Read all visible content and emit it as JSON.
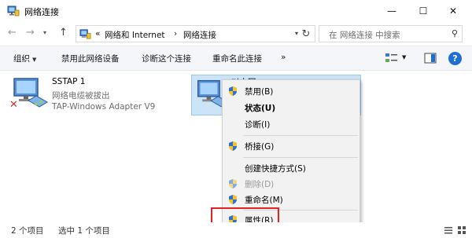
{
  "window": {
    "title": "网络连接",
    "minimize_glyph": "—",
    "maximize_glyph": "☐",
    "close_glyph": "✕"
  },
  "address": {
    "back_icon": "arrow-left-icon",
    "forward_icon": "arrow-right-icon",
    "up_icon": "arrow-up-icon",
    "back_glyph": "←",
    "forward_glyph": "→",
    "dropdown_glyph": "▾",
    "up_glyph": "↑",
    "overflow": "«",
    "crumb1": "网络和 Internet",
    "crumb_sep": "›",
    "crumb2": "网络连接",
    "refresh_glyph": "↻",
    "search_placeholder": "在 网络连接 中搜索",
    "search_glyph": "⚲"
  },
  "toolbar": {
    "organize": "组织",
    "disable": "禁用此网络设备",
    "diagnose": "诊断这个连接",
    "rename": "重命名此连接",
    "more": "»",
    "dd_glyph": "▼",
    "help_glyph": "?"
  },
  "connections": [
    {
      "name": "SSTAP 1",
      "status": "网络电缆被拔出",
      "adapter": "TAP-Windows Adapter V9",
      "error_glyph": "✕"
    },
    {
      "name": "以太网"
    }
  ],
  "context_menu": {
    "items": [
      {
        "label": "禁用(B)",
        "shield": true,
        "bold": false,
        "disabled": false
      },
      {
        "label": "状态(U)",
        "shield": false,
        "bold": true,
        "disabled": false
      },
      {
        "label": "诊断(I)",
        "shield": false,
        "bold": false,
        "disabled": false
      },
      {
        "label": "桥接(G)",
        "shield": true,
        "bold": false,
        "disabled": false
      },
      {
        "label": "创建快捷方式(S)",
        "shield": false,
        "bold": false,
        "disabled": false
      },
      {
        "label": "删除(D)",
        "shield": true,
        "bold": false,
        "disabled": true
      },
      {
        "label": "重命名(M)",
        "shield": true,
        "bold": false,
        "disabled": false
      },
      {
        "label": "属性(R)",
        "shield": true,
        "bold": false,
        "disabled": false
      }
    ]
  },
  "status_bar": {
    "item_count": "2 个项目",
    "selected_count": "选中 1 个项目"
  },
  "colors": {
    "selection_bg": "#cce4f7",
    "highlight_border": "#e32222",
    "help_blue": "#1e6fd3"
  }
}
